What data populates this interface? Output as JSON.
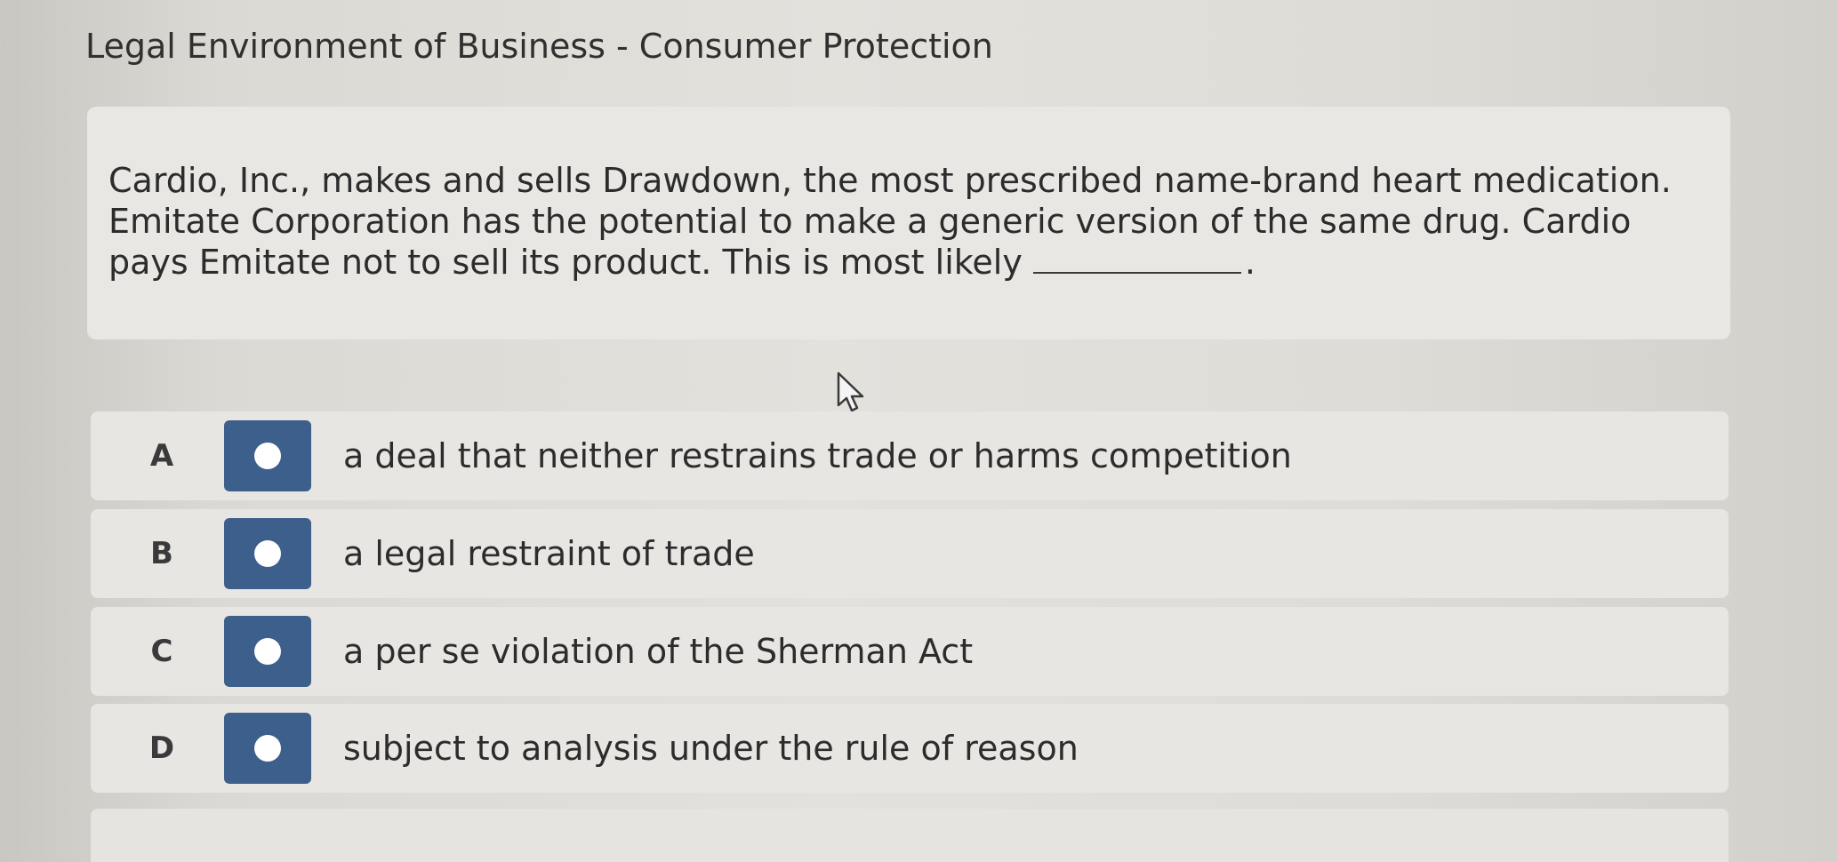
{
  "header": {
    "title": "Legal Environment of Business - Consumer Protection"
  },
  "question": {
    "text_before_blank": "Cardio, Inc., makes and sells Drawdown, the most prescribed name-brand heart medication. Emitate Corporation has the potential to make a generic version of the same drug. Cardio pays Emitate not to sell its product. This is most likely",
    "text_after_blank": "."
  },
  "options": [
    {
      "letter": "A",
      "text": "a deal that neither restrains trade or harms competition"
    },
    {
      "letter": "B",
      "text": "a legal restraint of trade"
    },
    {
      "letter": "C",
      "text": "a per se violation of the Sherman Act"
    },
    {
      "letter": "D",
      "text": "subject to analysis under the rule of reason"
    }
  ],
  "icons": {
    "cursor": "mouse-pointer-icon",
    "radio": "radio-button-icon"
  },
  "colors": {
    "radio_box": "#3d5f8c",
    "card_background": "#e9e7e3"
  }
}
